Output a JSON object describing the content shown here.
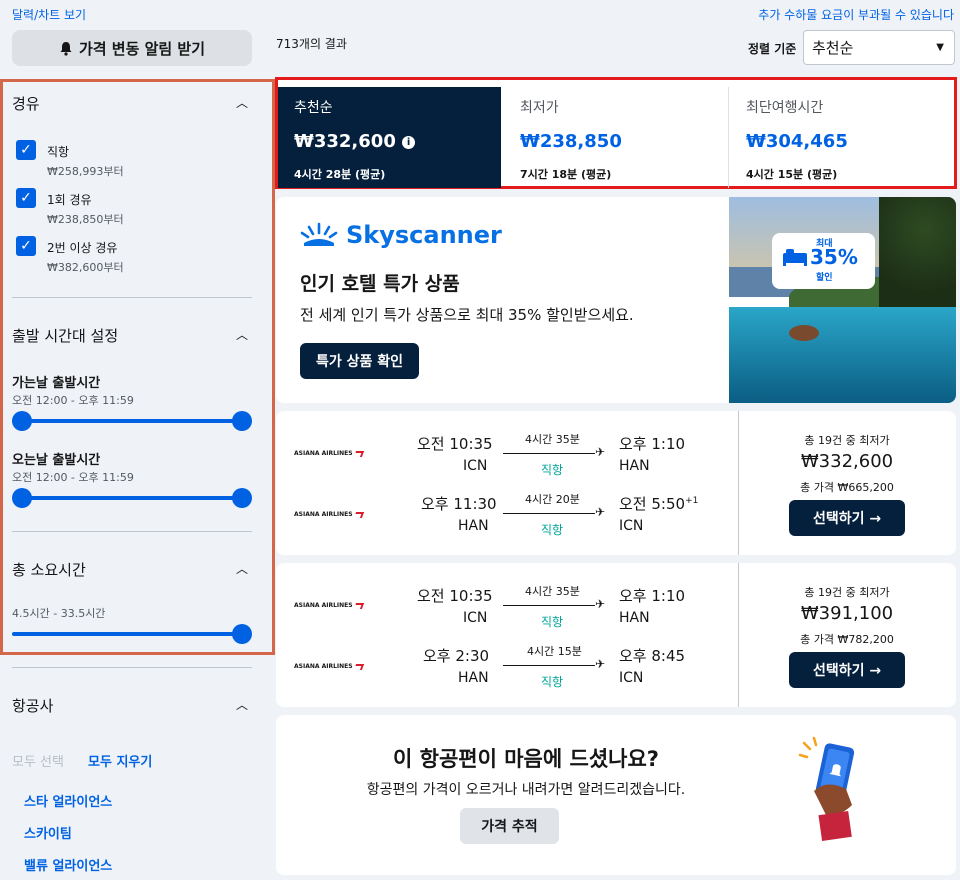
{
  "top": {
    "calendar_link": "달력/차트 보기",
    "fee_notice": "추가 수하물 요금이 부과될 수 있습니다",
    "alert_button": "가격 변동 알림 받기",
    "result_count": "713개의 결과",
    "sort_label": "정렬 기준",
    "sort_value": "추천순"
  },
  "sidebar": {
    "stops": {
      "title": "경유",
      "options": [
        {
          "label": "직항",
          "price": "₩258,993부터",
          "checked": true
        },
        {
          "label": "1회 경유",
          "price": "₩238,850부터",
          "checked": true
        },
        {
          "label": "2번 이상 경유",
          "price": "₩382,600부터",
          "checked": true
        }
      ]
    },
    "departure_time": {
      "title": "출발 시간대 설정",
      "outbound": {
        "title": "가는날 출발시간",
        "range": "오전 12:00 - 오후 11:59"
      },
      "inbound": {
        "title": "오는날 출발시간",
        "range": "오전 12:00 - 오후 11:59"
      }
    },
    "duration": {
      "title": "총 소요시간",
      "range": "4.5시간 - 33.5시간"
    },
    "airlines": {
      "title": "항공사",
      "select_all": "모두 선택",
      "clear_all": "모두 지우기",
      "alliances": [
        "스타 얼라이언스",
        "스카이팀",
        "밸류 얼라이언스"
      ]
    }
  },
  "tabs": [
    {
      "label": "추천순",
      "price": "₩332,600",
      "duration": "4시간 28분 (평균)",
      "active": true
    },
    {
      "label": "최저가",
      "price": "₩238,850",
      "duration": "7시간 18분 (평균)",
      "active": false
    },
    {
      "label": "최단여행시간",
      "price": "₩304,465",
      "duration": "4시간 15분 (평균)",
      "active": false
    }
  ],
  "ad": {
    "brand": "Skyscanner",
    "title": "인기 호텔 특가 상품",
    "subtitle": "전 세계 인기 특가 상품으로 최대 35% 할인받으세요.",
    "button": "특가 상품 확인",
    "badge_top": "최대",
    "badge_pct": "35%",
    "badge_bottom": "할인"
  },
  "flights": [
    {
      "legs": [
        {
          "airline": "ASIANA AIRLINES",
          "dep_time": "오전 10:35",
          "dep_code": "ICN",
          "duration": "4시간 35분",
          "stops": "직항",
          "arr_time": "오후 1:10",
          "arr_code": "HAN",
          "day_offset": ""
        },
        {
          "airline": "ASIANA AIRLINES",
          "dep_time": "오후 11:30",
          "dep_code": "HAN",
          "duration": "4시간 20분",
          "stops": "직항",
          "arr_time": "오전 5:50",
          "arr_code": "ICN",
          "day_offset": "+1"
        }
      ],
      "deal_count": "총 19건 중 최저가",
      "price": "₩332,600",
      "total": "총 가격 ₩665,200",
      "select": "선택하기 →"
    },
    {
      "legs": [
        {
          "airline": "ASIANA AIRLINES",
          "dep_time": "오전 10:35",
          "dep_code": "ICN",
          "duration": "4시간 35분",
          "stops": "직항",
          "arr_time": "오후 1:10",
          "arr_code": "HAN",
          "day_offset": ""
        },
        {
          "airline": "ASIANA AIRLINES",
          "dep_time": "오후 2:30",
          "dep_code": "HAN",
          "duration": "4시간 15분",
          "stops": "직항",
          "arr_time": "오후 8:45",
          "arr_code": "ICN",
          "day_offset": ""
        }
      ],
      "deal_count": "총 19건 중 최저가",
      "price": "₩391,100",
      "total": "총 가격 ₩782,200",
      "select": "선택하기 →"
    }
  ],
  "feedback": {
    "title": "이 항공편이 마음에 드셨나요?",
    "subtitle": "항공편의 가격이 오르거나 내려가면 알려드리겠습니다.",
    "button": "가격 추적"
  },
  "colors": {
    "accent": "#0062e3",
    "dark": "#05203c",
    "green": "#00a698",
    "highlight_red": "#e31b1b",
    "highlight_orange": "#d4674a"
  }
}
